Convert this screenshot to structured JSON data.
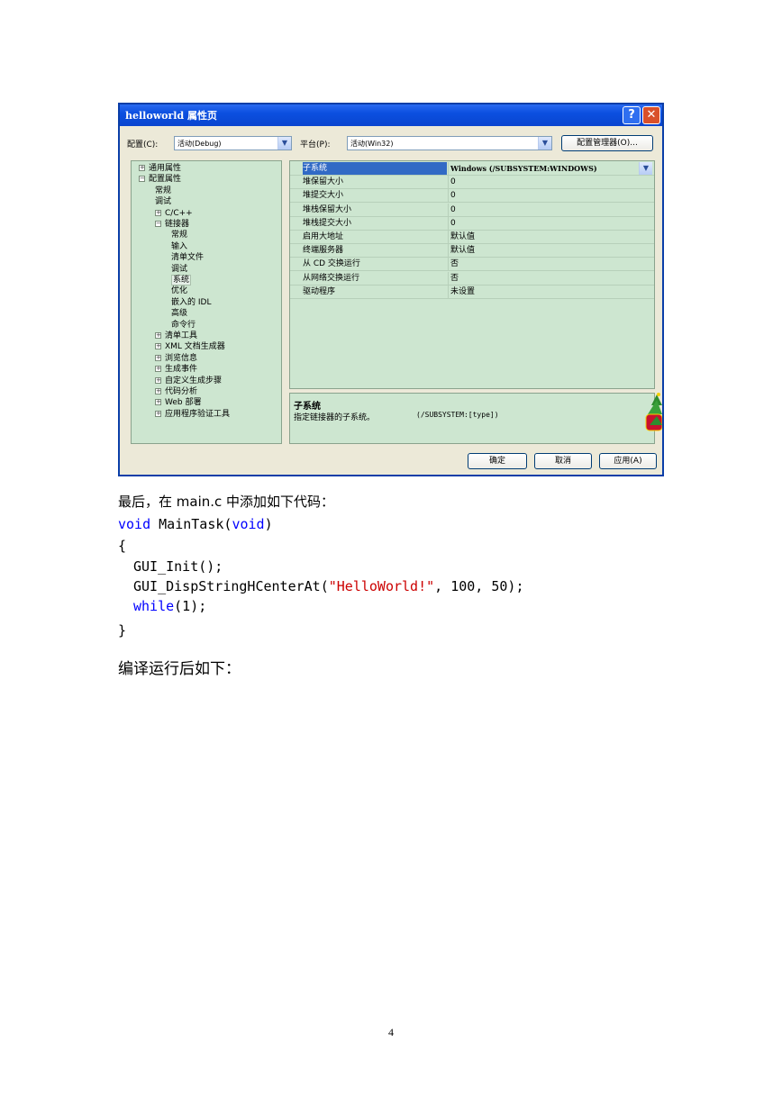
{
  "dialog": {
    "title": "helloworld 属性页",
    "help_label": "?",
    "close_label": "✕",
    "config_label": "配置(C):",
    "config_value": "活动(Debug)",
    "platform_label": "平台(P):",
    "platform_value": "活动(Win32)",
    "config_manager_label": "配置管理器(O)...",
    "tree": [
      {
        "label": "通用属性",
        "expander": "+",
        "depth": 0
      },
      {
        "label": "配置属性",
        "expander": "−",
        "depth": 0
      },
      {
        "label": "常规",
        "expander": "",
        "depth": 1
      },
      {
        "label": "调试",
        "expander": "",
        "depth": 1
      },
      {
        "label": "C/C++",
        "expander": "+",
        "depth": 1
      },
      {
        "label": "链接器",
        "expander": "−",
        "depth": 1
      },
      {
        "label": "常规",
        "expander": "",
        "depth": 2
      },
      {
        "label": "输入",
        "expander": "",
        "depth": 2
      },
      {
        "label": "清单文件",
        "expander": "",
        "depth": 2
      },
      {
        "label": "调试",
        "expander": "",
        "depth": 2
      },
      {
        "label": "系统",
        "expander": "",
        "depth": 2,
        "selected": true
      },
      {
        "label": "优化",
        "expander": "",
        "depth": 2
      },
      {
        "label": "嵌入的 IDL",
        "expander": "",
        "depth": 2
      },
      {
        "label": "高级",
        "expander": "",
        "depth": 2
      },
      {
        "label": "命令行",
        "expander": "",
        "depth": 2
      },
      {
        "label": "清单工具",
        "expander": "+",
        "depth": 1
      },
      {
        "label": "XML 文档生成器",
        "expander": "+",
        "depth": 1
      },
      {
        "label": "浏览信息",
        "expander": "+",
        "depth": 1
      },
      {
        "label": "生成事件",
        "expander": "+",
        "depth": 1
      },
      {
        "label": "自定义生成步骤",
        "expander": "+",
        "depth": 1
      },
      {
        "label": "代码分析",
        "expander": "+",
        "depth": 1
      },
      {
        "label": "Web 部署",
        "expander": "+",
        "depth": 1
      },
      {
        "label": "应用程序验证工具",
        "expander": "+",
        "depth": 1
      }
    ],
    "properties": [
      {
        "name": "子系统",
        "value": "Windows (/SUBSYSTEM:WINDOWS)",
        "selected": true
      },
      {
        "name": "堆保留大小",
        "value": "0"
      },
      {
        "name": "堆提交大小",
        "value": "0"
      },
      {
        "name": "堆栈保留大小",
        "value": "0"
      },
      {
        "name": "堆栈提交大小",
        "value": "0"
      },
      {
        "name": "启用大地址",
        "value": "默认值"
      },
      {
        "name": "终端服务器",
        "value": "默认值"
      },
      {
        "name": "从 CD 交换运行",
        "value": "否"
      },
      {
        "name": "从网络交换运行",
        "value": "否"
      },
      {
        "name": "驱动程序",
        "value": "未设置"
      }
    ],
    "description_title": "子系统",
    "description_text": "指定链接器的子系统。",
    "description_code": "(/SUBSYSTEM:[type])",
    "ok_label": "确定",
    "cancel_label": "取消",
    "apply_label": "应用(A)"
  },
  "document": {
    "intro": "最后，在 main.c 中添加如下代码：",
    "code": {
      "line1_kw": "void",
      "line1_name": " MainTask(",
      "line1_kw2": "void",
      "line1_end": ")",
      "open_brace": "{",
      "line3": "GUI_Init();",
      "line4_pre": "GUI_DispStringHCenterAt(",
      "line4_str": "\"HelloWorld!\"",
      "line4_post": ", 100, 50);",
      "line5_kw": "while",
      "line5_post": "(1);",
      "close_brace": "}"
    },
    "outro": "编译运行后如下：",
    "page_number": "4"
  }
}
